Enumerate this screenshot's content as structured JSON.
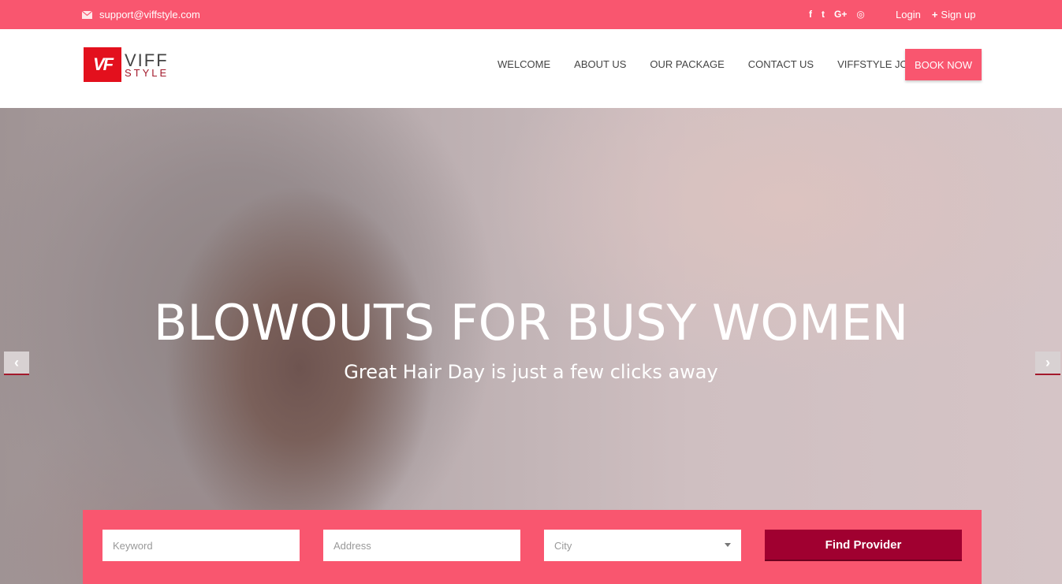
{
  "topbar": {
    "email": "support@viffstyle.com",
    "social": {
      "facebook": "f",
      "twitter": "t",
      "google": "G+",
      "instagram": "◎"
    },
    "login": "Login",
    "plus": "+",
    "signup": "Sign up"
  },
  "brand": {
    "mark": "VF",
    "line1": "VIFF",
    "line2": "STYLE",
    "color": "#e3101d"
  },
  "nav": {
    "items": [
      "WELCOME",
      "ABOUT US",
      "OUR PACKAGE",
      "CONTACT US",
      "VIFFSTYLE JOURNAL"
    ],
    "book": "BOOK NOW"
  },
  "hero": {
    "title": "BLOWOUTS FOR BUSY WOMEN",
    "subtitle": "Great Hair Day is just a few clicks away",
    "prev_arrow": "‹",
    "next_arrow": "›"
  },
  "search": {
    "keyword_placeholder": "Keyword",
    "address_placeholder": "Address",
    "city_selected": "City",
    "button": "Find Provider"
  },
  "colors": {
    "accent": "#f9566f",
    "button_dark": "#a00030"
  }
}
